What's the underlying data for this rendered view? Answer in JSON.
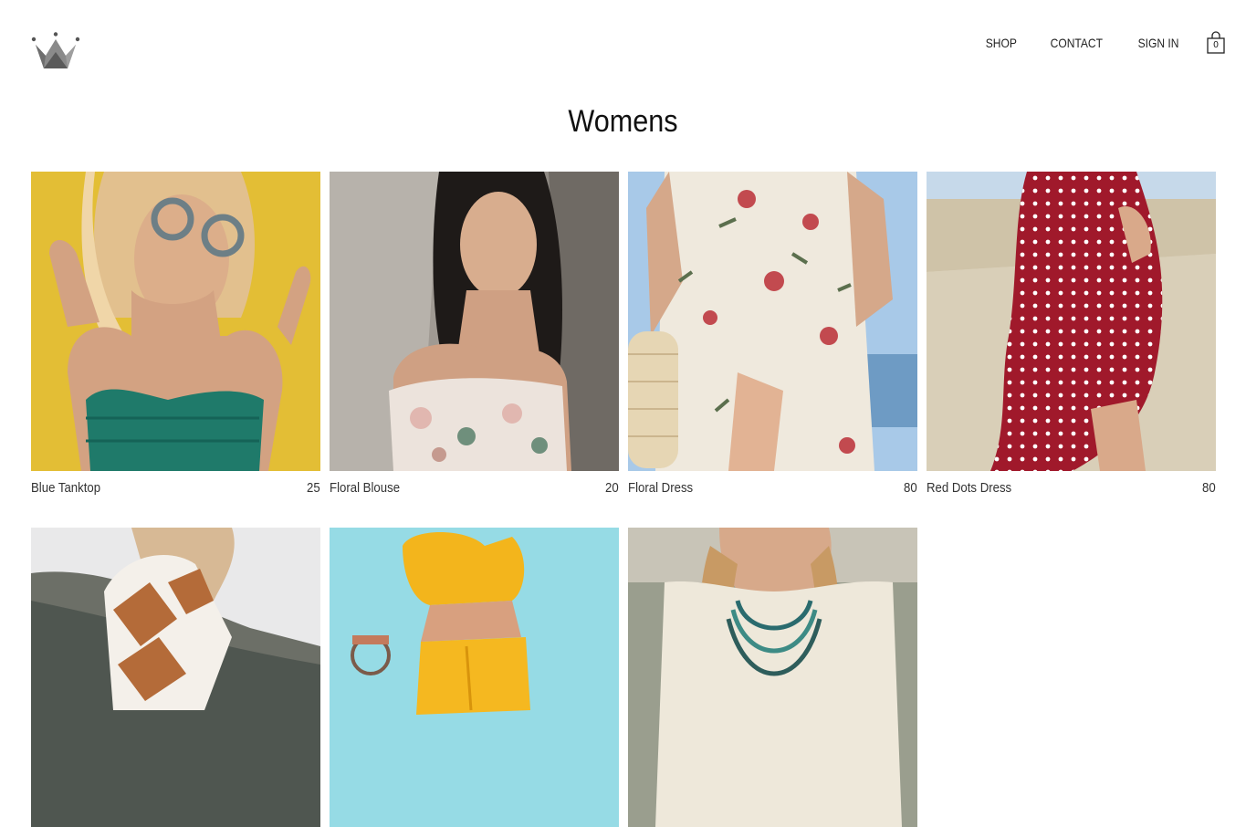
{
  "header": {
    "logo_icon": "crown-icon",
    "nav": [
      {
        "label": "SHOP"
      },
      {
        "label": "CONTACT"
      },
      {
        "label": "SIGN IN"
      }
    ],
    "cart": {
      "icon": "shopping-bag-icon",
      "count": "0"
    }
  },
  "page": {
    "title": "Womens"
  },
  "products": [
    {
      "name": "Blue Tanktop",
      "price": "25"
    },
    {
      "name": "Floral Blouse",
      "price": "20"
    },
    {
      "name": "Floral Dress",
      "price": "80"
    },
    {
      "name": "Red Dots Dress",
      "price": "80"
    },
    {
      "name": "",
      "price": ""
    },
    {
      "name": "",
      "price": ""
    },
    {
      "name": "",
      "price": ""
    }
  ]
}
